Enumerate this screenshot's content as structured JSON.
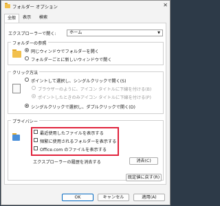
{
  "window": {
    "title": "フォルダー オプション",
    "close_glyph": "✕"
  },
  "tabs": [
    {
      "label": "全般",
      "active": true
    },
    {
      "label": "表示",
      "active": false
    },
    {
      "label": "検索",
      "active": false
    }
  ],
  "open_explorer": {
    "label": "エクスプローラーで開く:",
    "value": "ホーム"
  },
  "browse_folders": {
    "title": "フォルダーの参照",
    "options": [
      {
        "label": "同じウィンドウでフォルダーを開く",
        "selected": true
      },
      {
        "label": "フォルダーごとに新しいウィンドウで開く",
        "selected": false
      }
    ]
  },
  "click_method": {
    "title": "クリック方法",
    "options": [
      {
        "label": "ポイントして選択し、シングルクリックで開く(S)",
        "selected": false,
        "enabled": true
      },
      {
        "label": "ブラウザーのように、アイコン タイトルに下線を付ける(B)",
        "selected": false,
        "enabled": false
      },
      {
        "label": "ポイントしたときのみアイコン タイトルに下線を付ける(P)",
        "selected": true,
        "enabled": false
      },
      {
        "label": "シングルクリックで選択し、ダブルクリックで開く(D)",
        "selected": true,
        "enabled": true
      }
    ]
  },
  "privacy": {
    "title": "プライバシー",
    "checks": [
      {
        "label": "最近使用したファイルを表示する",
        "checked": false
      },
      {
        "label": "頻繁に使用されるフォルダーを表示する",
        "checked": false
      },
      {
        "label": "Office.com のファイルを表示する",
        "checked": false
      }
    ],
    "clear_label": "エクスプローラーの履歴を消去する",
    "clear_button": "消去(C)"
  },
  "restore_button": "既定値に戻す(R)",
  "footer": {
    "ok": "OK",
    "cancel": "キャンセル",
    "apply": "適用(A)"
  },
  "colors": {
    "highlight_border": "#e0203a",
    "primary_border": "#0067c0"
  }
}
